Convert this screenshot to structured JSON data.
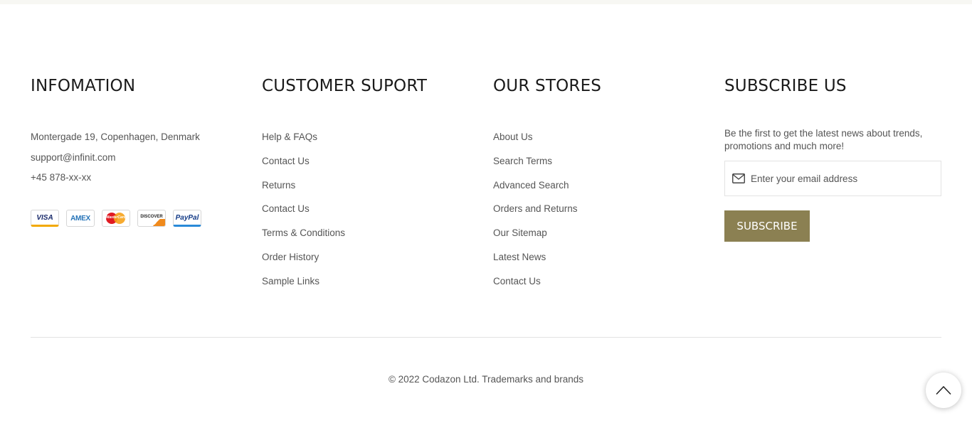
{
  "info": {
    "title": "INFOMATION",
    "address": "Montergade 19, Copenhagen, Denmark",
    "email": "support@infinit.com",
    "phone": "+45 878-xx-xx",
    "payments": [
      {
        "name": "visa",
        "label": "VISA"
      },
      {
        "name": "amex",
        "label": "AMEX"
      },
      {
        "name": "mastercard",
        "label": "MasterCard"
      },
      {
        "name": "discover",
        "label": "DISCOVER"
      },
      {
        "name": "paypal",
        "label": "PayPal"
      }
    ]
  },
  "support": {
    "title": "CUSTOMER SUPORT",
    "links": [
      "Help & FAQs",
      "Contact Us",
      "Returns",
      "Contact Us",
      "Terms & Conditions",
      "Order History",
      "Sample Links"
    ]
  },
  "stores": {
    "title": "OUR STORES",
    "links": [
      "About Us",
      "Search Terms",
      "Advanced Search",
      "Orders and Returns",
      "Our Sitemap",
      "Latest News",
      "Contact Us"
    ]
  },
  "subscribe": {
    "title": "SUBSCRIBE US",
    "text": "Be the first to get the latest news about trends, promotions and much more!",
    "placeholder": "Enter your email address",
    "button": "SUBSCRIBE",
    "button_color": "#8b8052"
  },
  "copyright": "© 2022 Codazon Ltd. Trademarks and brands",
  "icons": {
    "mail": "mail-icon",
    "back_to_top": "chevron-up-icon"
  }
}
